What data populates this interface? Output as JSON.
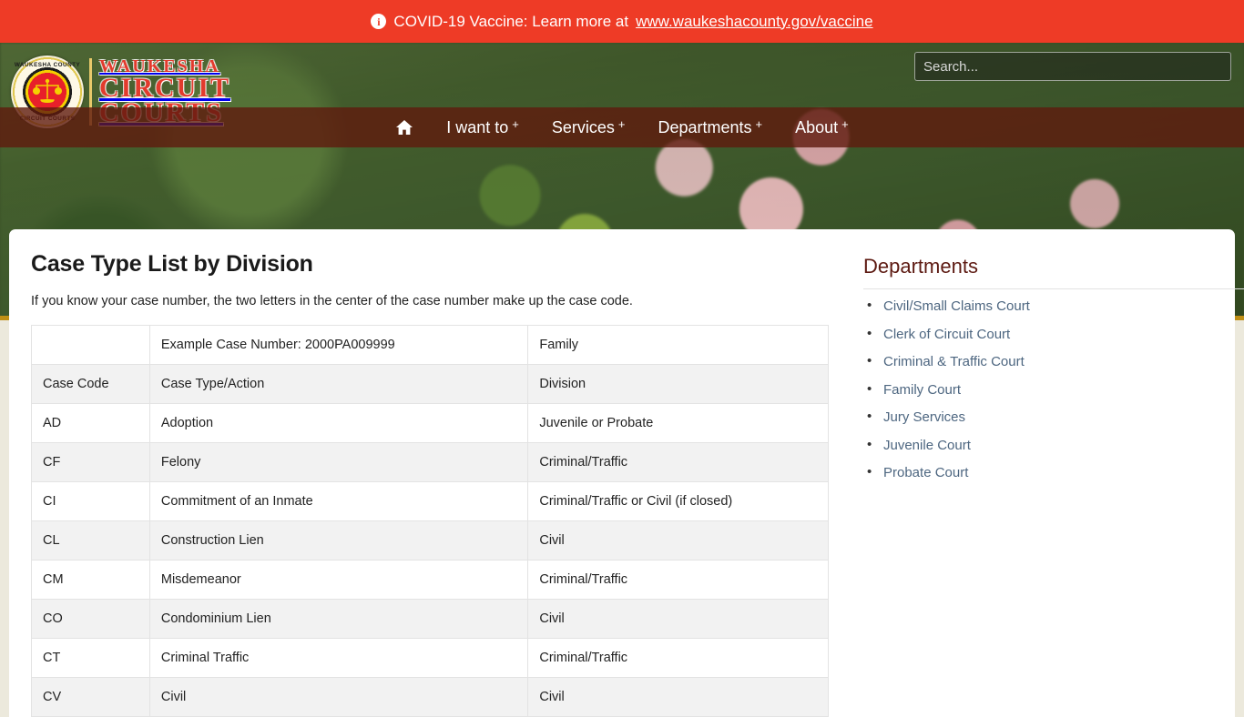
{
  "banner": {
    "icon": "info-circle-icon",
    "text_prefix": "COVID-19 Vaccine: Learn more at",
    "link_text": "www.waukeshacounty.gov/vaccine",
    "background_color": "#ee3b26"
  },
  "header": {
    "seal": {
      "top_text": "WAUKESHA COUNTY",
      "bottom_text": "CIRCUIT COURTS",
      "icon": "scales-of-justice-icon"
    },
    "wordmark": {
      "line1": "WAUKESHA",
      "line2": "CIRCUIT",
      "line3": "COURTS",
      "color": "#e23b2d"
    },
    "search": {
      "placeholder": "Search...",
      "value": ""
    },
    "nav": {
      "home_icon": "home-icon",
      "items": [
        {
          "label": "I want to",
          "expander": "+"
        },
        {
          "label": "Services",
          "expander": "+"
        },
        {
          "label": "Departments",
          "expander": "+"
        },
        {
          "label": "About",
          "expander": "+"
        }
      ],
      "background_color": "#5f1a0e"
    },
    "accent_stripe_color": "#c08f16"
  },
  "main": {
    "title": "Case Type List by Division",
    "intro": "If you know your case number, the two letters in the center of the case number make up the case code.",
    "table": {
      "rows": [
        {
          "code": "",
          "type": "Example Case Number: 2000PA009999",
          "division": "Family"
        },
        {
          "code": "Case Code",
          "type": "Case Type/Action",
          "division": "Division"
        },
        {
          "code": "AD",
          "type": "Adoption",
          "division": "Juvenile or Probate"
        },
        {
          "code": "CF",
          "type": "Felony",
          "division": "Criminal/Traffic"
        },
        {
          "code": "CI",
          "type": "Commitment of an Inmate",
          "division": "Criminal/Traffic or Civil (if closed)"
        },
        {
          "code": "CL",
          "type": "Construction Lien",
          "division": "Civil"
        },
        {
          "code": "CM",
          "type": "Misdemeanor",
          "division": "Criminal/Traffic"
        },
        {
          "code": "CO",
          "type": "Condominium Lien",
          "division": "Civil"
        },
        {
          "code": "CT",
          "type": "Criminal Traffic",
          "division": "Criminal/Traffic"
        },
        {
          "code": "CV",
          "type": "Civil",
          "division": "Civil"
        }
      ]
    }
  },
  "sidebar": {
    "title": "Departments",
    "title_color": "#5d1a12",
    "link_color": "#4d6680",
    "items": [
      {
        "label": "Civil/Small Claims Court"
      },
      {
        "label": "Clerk of Circuit Court"
      },
      {
        "label": "Criminal & Traffic Court"
      },
      {
        "label": "Family Court"
      },
      {
        "label": "Jury Services"
      },
      {
        "label": "Juvenile Court"
      },
      {
        "label": "Probate Court"
      }
    ]
  }
}
